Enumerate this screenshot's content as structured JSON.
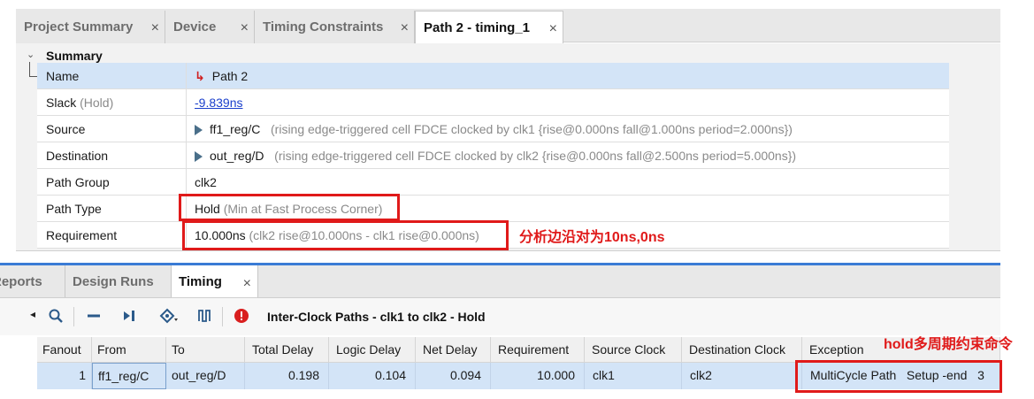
{
  "top_tabs": [
    {
      "label": "Project Summary"
    },
    {
      "label": "Device"
    },
    {
      "label": "Timing Constraints"
    },
    {
      "label": "Path 2 - timing_1"
    }
  ],
  "summary": {
    "header": "Summary",
    "rows": [
      {
        "name": "Name",
        "value": "Path 2"
      },
      {
        "name": "Slack",
        "name_suffix": "(Hold)",
        "value": "-9.839ns"
      },
      {
        "name": "Source",
        "value": "ff1_reg/C",
        "detail": "(rising edge-triggered cell FDCE clocked by clk1  {rise@0.000ns fall@1.000ns period=2.000ns})"
      },
      {
        "name": "Destination",
        "value": "out_reg/D",
        "detail": "(rising edge-triggered cell FDCE clocked by clk2  {rise@0.000ns fall@2.500ns period=5.000ns})"
      },
      {
        "name": "Path Group",
        "value": "clk2"
      },
      {
        "name": "Path Type",
        "value": "Hold",
        "detail": "(Min at Fast Process Corner)"
      },
      {
        "name": "Requirement",
        "value": "10.000ns",
        "detail": "(clk2 rise@10.000ns - clk1 rise@0.000ns)"
      }
    ]
  },
  "annotations": {
    "requirement_note": "分析边沿对为10ns,0ns",
    "hold_note": "hold多周期约束命令",
    "highlight_color": "#e01a1a"
  },
  "bottom_tabs": [
    {
      "label": "Reports"
    },
    {
      "label": "Design Runs"
    },
    {
      "label": "Timing"
    }
  ],
  "toolbar": {
    "icons": [
      "search-icon",
      "collapse-icon",
      "jump-icon",
      "highlight-icon",
      "waveform-icon",
      "error-icon"
    ],
    "title": "Inter-Clock Paths - clk1 to clk2 - Hold"
  },
  "table": {
    "columns": [
      "Fanout",
      "From",
      "To",
      "Total Delay",
      "Logic Delay",
      "Net Delay",
      "Requirement",
      "Source Clock",
      "Destination Clock",
      "Exception"
    ],
    "rows": [
      {
        "fanout": "1",
        "from": "ff1_reg/C",
        "to": "out_reg/D",
        "total_delay": "0.198",
        "logic_delay": "0.104",
        "net_delay": "0.094",
        "requirement": "10.000",
        "source_clock": "clk1",
        "destination_clock": "clk2",
        "exception": "MultiCycle Path   Setup -end   3"
      }
    ]
  },
  "colors": {
    "selection": "#d3e4f7",
    "link": "#1a3fcc",
    "accent_blue": "#3a7bd5"
  }
}
